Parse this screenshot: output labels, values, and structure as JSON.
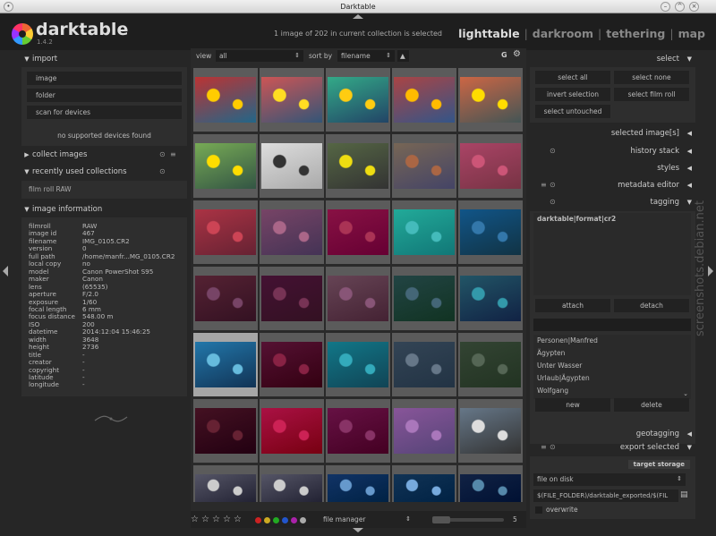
{
  "window": {
    "title": "Darktable"
  },
  "app": {
    "name": "darktable",
    "version": "1.4.2"
  },
  "status_text": "1 image of 202 in current collection is selected",
  "views": {
    "active": "lighttable",
    "items": [
      "lighttable",
      "darkroom",
      "tethering",
      "map"
    ],
    "separator": "|"
  },
  "left_panel": {
    "import": {
      "header": "import",
      "buttons": [
        "image",
        "folder",
        "scan for devices"
      ],
      "note": "no supported devices found"
    },
    "collect_images": {
      "header": "collect images"
    },
    "recently_used": {
      "header": "recently used collections",
      "item": "film roll RAW"
    },
    "image_information": {
      "header": "image information",
      "rows": [
        {
          "key": "filmroll",
          "value": "RAW"
        },
        {
          "key": "image id",
          "value": "467"
        },
        {
          "key": "filename",
          "value": "IMG_0105.CR2"
        },
        {
          "key": "version",
          "value": "0"
        },
        {
          "key": "full path",
          "value": "/home/manfr...MG_0105.CR2"
        },
        {
          "key": "local copy",
          "value": "no"
        },
        {
          "key": "model",
          "value": "Canon PowerShot S95"
        },
        {
          "key": "maker",
          "value": "Canon"
        },
        {
          "key": "lens",
          "value": "(65535)"
        },
        {
          "key": "aperture",
          "value": "F/2.0"
        },
        {
          "key": "exposure",
          "value": "1/60"
        },
        {
          "key": "focal length",
          "value": "6 mm"
        },
        {
          "key": "focus distance",
          "value": "548.00 m"
        },
        {
          "key": "ISO",
          "value": "200"
        },
        {
          "key": "datetime",
          "value": "2014:12:04 15:46:25"
        },
        {
          "key": "width",
          "value": "3648"
        },
        {
          "key": "height",
          "value": "2736"
        },
        {
          "key": "title",
          "value": "-"
        },
        {
          "key": "creator",
          "value": "-"
        },
        {
          "key": "copyright",
          "value": "-"
        },
        {
          "key": "latitude",
          "value": "-"
        },
        {
          "key": "longitude",
          "value": "-"
        }
      ]
    }
  },
  "center": {
    "view_label": "view",
    "view_value": "all",
    "sort_label": "sort by",
    "sort_value": "filename",
    "sort_direction_icon": "up-arrow-icon",
    "g_label": "G",
    "selected_thumbnail": "row 5, column 1",
    "bottom": {
      "stars": [
        "☆",
        "☆",
        "☆",
        "☆",
        "☆"
      ],
      "color_labels": [
        "#cc2222",
        "#ccaa22",
        "#22aa22",
        "#2255cc",
        "#aa22aa",
        "#aaaaaa"
      ],
      "layout": "file manager",
      "zoom_value": "5"
    }
  },
  "right_panel": {
    "select": {
      "header": "select",
      "buttons": [
        "select all",
        "select none",
        "invert selection",
        "select film roll",
        "select untouched"
      ]
    },
    "selected_images": {
      "header": "selected image[s]"
    },
    "history_stack": {
      "header": "history stack"
    },
    "styles": {
      "header": "styles"
    },
    "metadata_editor": {
      "header": "metadata editor"
    },
    "tagging": {
      "header": "tagging",
      "attached_tag": "darktable|format|cr2",
      "attach": "attach",
      "detach": "detach",
      "entry_value": "",
      "dictionary": [
        "Personen|Manfred",
        "Ägypten",
        "Unter Wasser",
        "Urlaub|Ägypten",
        "Wolfgang"
      ],
      "new": "new",
      "delete": "delete"
    },
    "geotagging": {
      "header": "geotagging"
    },
    "export_selected": {
      "header": "export selected",
      "target_storage_label": "target storage",
      "storage": "file on disk",
      "path": "$(FILE_FOLDER)/darktable_exported/$(FIL",
      "overwrite": "overwrite"
    }
  },
  "watermark": "screenshots.debian.net"
}
